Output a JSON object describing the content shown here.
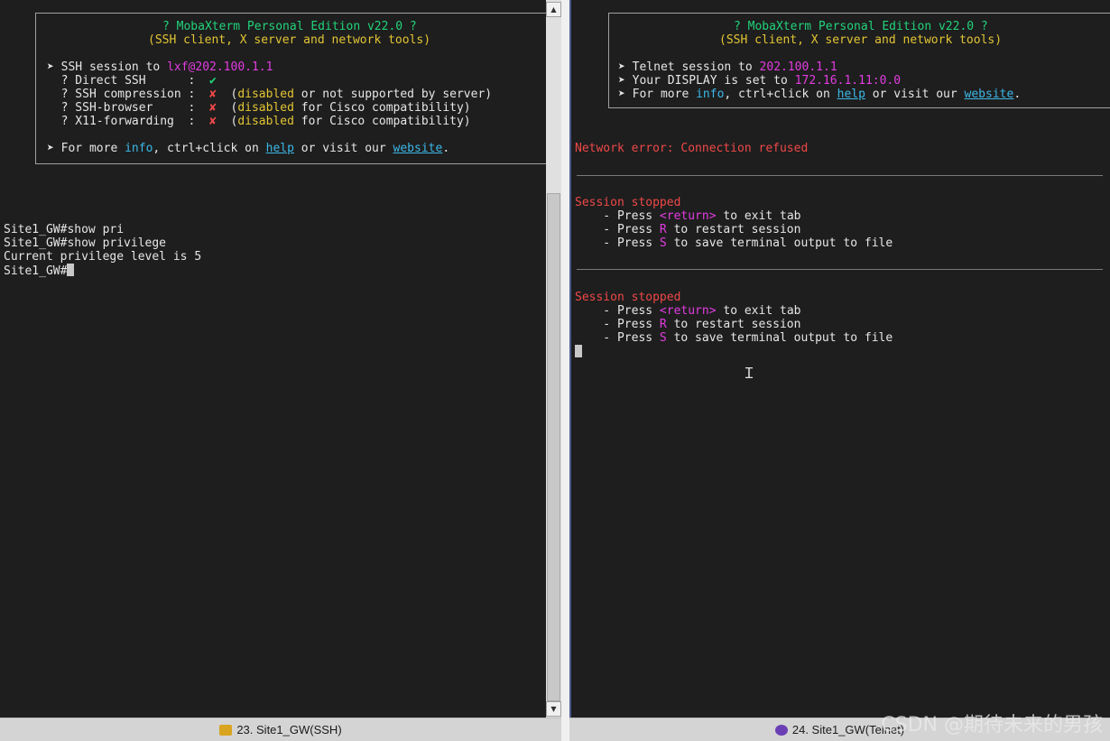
{
  "left": {
    "banner": {
      "title": "? MobaXterm Personal Edition v22.0 ?",
      "subtitle": "(SSH client, X server and network tools)",
      "session_prefix": "➤ SSH session to ",
      "session_target": "lxf@202.100.1.1",
      "direct_ssh_label": "  ? Direct SSH      :  ",
      "direct_ssh_value": "✔",
      "compression_label": "  ? SSH compression :  ",
      "compression_mark": "✘",
      "compression_open": "  (",
      "compression_status": "disabled",
      "compression_reason": " or not supported by server)",
      "browser_label": "  ? SSH-browser     :  ",
      "browser_mark": "✘",
      "browser_open": "  (",
      "browser_status": "disabled",
      "browser_reason": " for Cisco compatibility)",
      "x11_label": "  ? X11-forwarding  :  ",
      "x11_mark": "✘",
      "x11_open": "  (",
      "x11_status": "disabled",
      "x11_reason": " for Cisco compatibility)",
      "more_prefix": "➤ For more ",
      "more_info": "info",
      "more_mid": ", ctrl+click on ",
      "more_help": "help",
      "more_or": " or visit our ",
      "more_website": "website",
      "more_end": "."
    },
    "output": [
      "Site1_GW#show pri",
      "Site1_GW#show privilege",
      "Current privilege level is 5"
    ],
    "prompt": "Site1_GW#",
    "status_tab": "23. Site1_GW(SSH)",
    "scroll_up": "▲",
    "scroll_down": "▼"
  },
  "right": {
    "banner": {
      "title": "? MobaXterm Personal Edition v22.0 ?",
      "subtitle": "(SSH client, X server and network tools)",
      "session_prefix": "➤ Telnet session to ",
      "session_target": "202.100.1.1",
      "display_prefix": "➤ Your DISPLAY is set to ",
      "display_value": "172.16.1.11:0.0",
      "more_prefix": "➤ For more ",
      "more_info": "info",
      "more_mid": ", ctrl+click on ",
      "more_help": "help",
      "more_or": " or visit our ",
      "more_website": "website",
      "more_end": "."
    },
    "network_error": "Network error: Connection refused",
    "stopped_blocks": [
      {
        "title": "Session stopped",
        "l1_pre": "    - Press ",
        "l1_key": "<return>",
        "l1_post": " to exit tab",
        "l2_pre": "    - Press ",
        "l2_key": "R",
        "l2_post": " to restart session",
        "l3_pre": "    - Press ",
        "l3_key": "S",
        "l3_post": " to save terminal output to file"
      },
      {
        "title": "Session stopped",
        "l1_pre": "    - Press ",
        "l1_key": "<return>",
        "l1_post": " to exit tab",
        "l2_pre": "    - Press ",
        "l2_key": "R",
        "l2_post": " to restart session",
        "l3_pre": "    - Press ",
        "l3_key": "S",
        "l3_post": " to save terminal output to file"
      }
    ],
    "status_tab": "24. Site1_GW(Telnet)"
  },
  "watermark": "CSDN @期待未来的男孩",
  "icons": {
    "ssh_tab": "wrench-key-icon",
    "telnet_tab": "telnet-globe-icon"
  },
  "colors": {
    "terminal_bg": "#1e1e1e",
    "green": "#22d37a",
    "yellow": "#e2c534",
    "magenta": "#e23ce0",
    "cyan": "#3cb8e8",
    "red": "#ef4848"
  }
}
